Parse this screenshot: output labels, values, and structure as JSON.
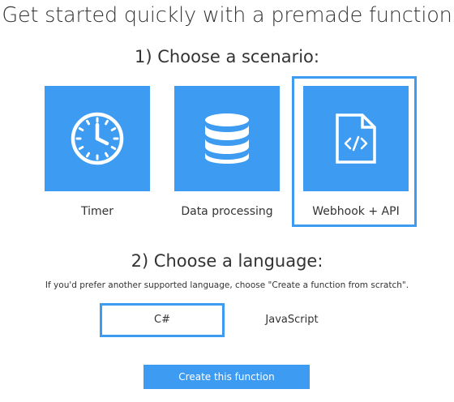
{
  "title": "Get started quickly with a premade function",
  "step1": {
    "heading": "1) Choose a scenario:",
    "scenarios": [
      {
        "label": "Timer",
        "icon": "clock-icon",
        "selected": false
      },
      {
        "label": "Data processing",
        "icon": "database-icon",
        "selected": false
      },
      {
        "label": "Webhook + API",
        "icon": "code-file-icon",
        "selected": true
      }
    ]
  },
  "step2": {
    "heading": "2) Choose a language:",
    "hint": "If you'd prefer another supported language, choose \"Create a function from scratch\".",
    "languages": [
      {
        "label": "C#",
        "selected": true
      },
      {
        "label": "JavaScript",
        "selected": false
      }
    ]
  },
  "create_button": {
    "label": "Create this function"
  },
  "colors": {
    "accent": "#3d9bf2",
    "text": "#333333",
    "background": "#ffffff"
  }
}
